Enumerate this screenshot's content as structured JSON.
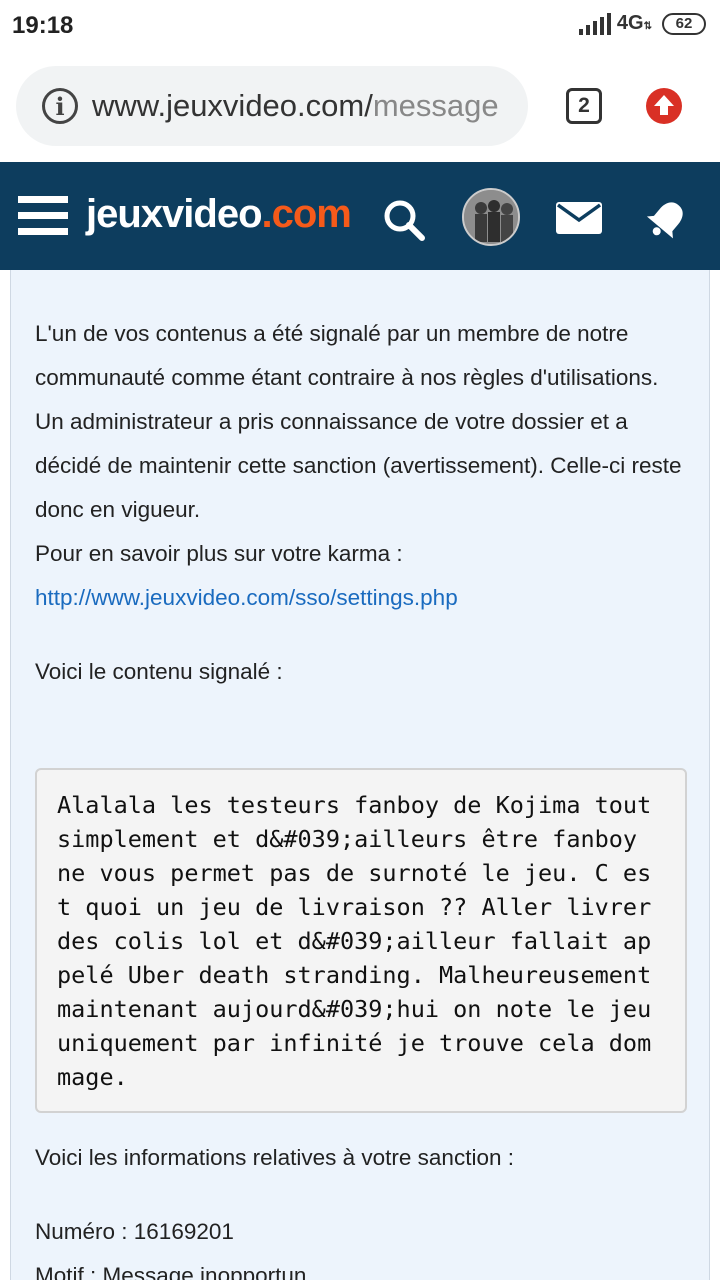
{
  "status_bar": {
    "time": "19:18",
    "network": "4G",
    "battery": "62"
  },
  "browser": {
    "url_main": "www.jeuxvideo.com/",
    "url_rest": "message",
    "tab_count": "2"
  },
  "site": {
    "logo_main": "jeuxvideo",
    "logo_suffix": ".com",
    "colors": {
      "header": "#0d3d5e",
      "logo_accent": "#f55a1a",
      "link": "#1a6bbf"
    }
  },
  "message": {
    "paragraph_1": "L'un de vos contenus a été signalé par un membre de notre communauté comme étant contraire à nos règles d'utilisations.",
    "paragraph_2": "Un administrateur a pris connaissance de votre dossier et a décidé de maintenir cette sanction (avertissement). Celle-ci reste donc en vigueur.",
    "karma_label": "Pour en savoir plus sur votre karma :",
    "karma_link": "http://www.jeuxvideo.com/sso/settings.php",
    "reported_intro": "Voici le contenu signalé :",
    "reported_lines": [
      "Alalala les testeurs fanboy de Kojima tout",
      "simplement et d&#039;ailleurs être fanboy",
      "ne vous permet pas de surnoté le jeu. C es",
      "t quoi un jeu de livraison ?? Aller livrer",
      "des colis lol et d&#039;ailleur fallait ap",
      "pelé Uber death stranding. Malheureusement",
      "maintenant aujourd&#039;hui on note le jeu",
      "uniquement par infinité je trouve cela dom",
      "mage."
    ],
    "sanction_intro": "Voici les informations relatives à votre sanction :",
    "numero": "Numéro : 16169201",
    "motif": "Motif : Message inopportun"
  }
}
